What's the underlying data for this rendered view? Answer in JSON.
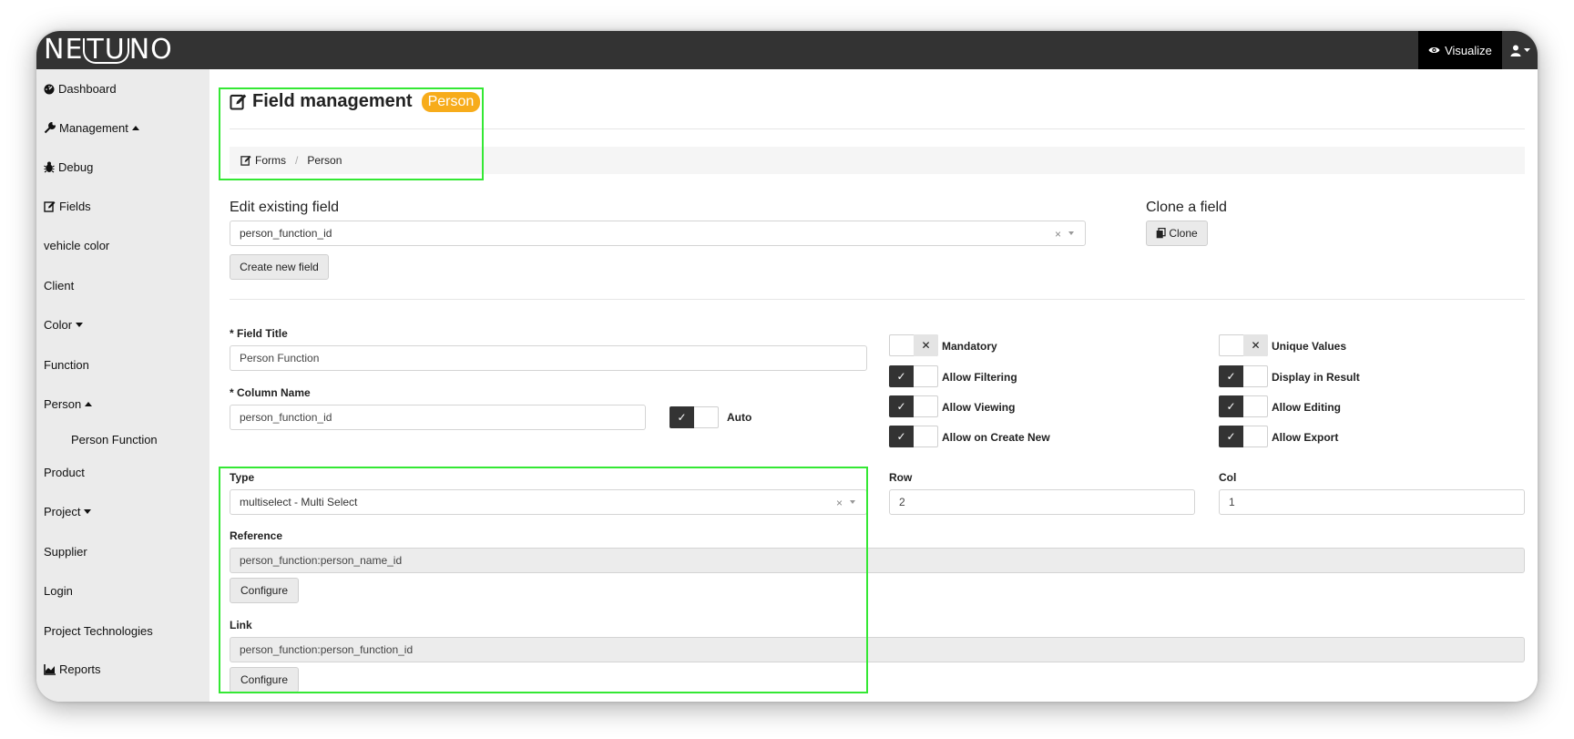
{
  "app": {
    "logo_text_1": "NE",
    "logo_text_2": "TU",
    "logo_text_3": "NO",
    "visualize_label": "Visualize"
  },
  "sidebar": {
    "items": [
      {
        "label": "Dashboard",
        "icon": "dashboard-icon"
      },
      {
        "label": "Management",
        "icon": "wrench-icon",
        "caret": "up"
      },
      {
        "label": "Debug",
        "icon": "bug-icon"
      },
      {
        "label": "Fields",
        "icon": "edit-icon"
      },
      {
        "label": "vehicle color"
      },
      {
        "label": "Client"
      },
      {
        "label": "Color",
        "caret": "down"
      },
      {
        "label": "Function"
      },
      {
        "label": "Person",
        "caret": "up"
      },
      {
        "label": "Person Function",
        "sub": true
      },
      {
        "label": "Product"
      },
      {
        "label": "Project",
        "caret": "down"
      },
      {
        "label": "Supplier"
      },
      {
        "label": "Login"
      },
      {
        "label": "Project Technologies"
      },
      {
        "label": "Reports",
        "icon": "chart-icon"
      }
    ]
  },
  "header": {
    "title": "Field management",
    "badge": "Person"
  },
  "breadcrumb": {
    "forms": "Forms",
    "separator": "/",
    "current": "Person"
  },
  "edit_section": {
    "title": "Edit existing field",
    "selected_field": "person_function_id",
    "clear": "×",
    "create_button": "Create new field"
  },
  "clone_section": {
    "title": "Clone a field",
    "clone_button": "Clone"
  },
  "form": {
    "field_title_label": "* Field Title",
    "field_title_value": "Person Function",
    "column_name_label": "* Column Name",
    "column_name_value": "person_function_id",
    "auto_label": "Auto",
    "type_label": "Type",
    "type_value": "multiselect - Multi Select",
    "type_clear": "×",
    "reference_label": "Reference",
    "reference_value": "person_function:person_name_id",
    "reference_configure": "Configure",
    "link_label": "Link",
    "link_value": "person_function:person_function_id",
    "link_configure": "Configure",
    "row_label": "Row",
    "row_value": "2",
    "col_label": "Col",
    "col_value": "1"
  },
  "toggles": {
    "auto": true,
    "mandatory": {
      "label": "Mandatory",
      "on": false
    },
    "allow_filtering": {
      "label": "Allow Filtering",
      "on": true
    },
    "allow_viewing": {
      "label": "Allow Viewing",
      "on": true
    },
    "allow_on_create_new": {
      "label": "Allow on Create New",
      "on": true
    },
    "unique_values": {
      "label": "Unique Values",
      "on": false
    },
    "display_in_result": {
      "label": "Display in Result",
      "on": true
    },
    "allow_editing": {
      "label": "Allow Editing",
      "on": true
    },
    "allow_export": {
      "label": "Allow Export",
      "on": true
    }
  },
  "glyphs": {
    "check": "✓",
    "cross": "✕"
  },
  "colors": {
    "topbar": "#333333",
    "badge": "#f7ac1b",
    "highlight": "#34e834",
    "toggle_on": "#333333"
  }
}
